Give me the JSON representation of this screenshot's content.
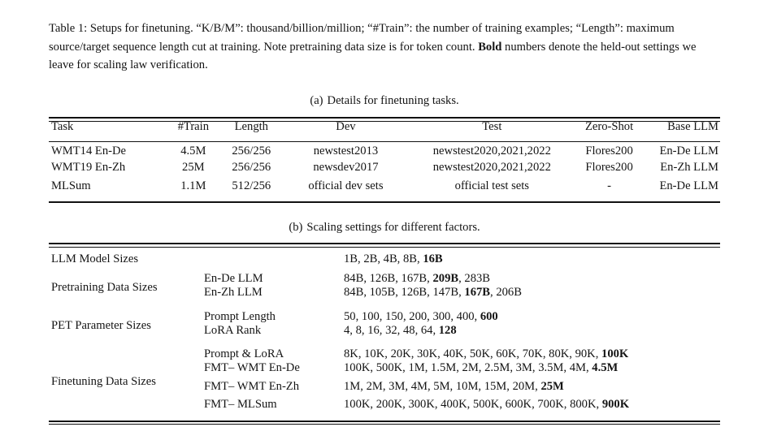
{
  "caption": {
    "lines": [
      "Table 1:  Setups for finetuning. “K/B/M”: thousand/billion/million; “#Train”: the number of training examples;",
      "“Length”: maximum source/target sequence length cut at training. Note pretraining data size is for token count.",
      "numbers denote the held-out settings we leave for scaling law verification."
    ],
    "bold_lead": "Bold"
  },
  "subtable_a": {
    "label": "(a)",
    "title": "Details for finetuning tasks.",
    "headers": [
      "Task",
      "#Train",
      "Length",
      "Dev",
      "Test",
      "Zero-Shot",
      "Base LLM"
    ],
    "rows": [
      {
        "task": "WMT14 En-De",
        "train": "4.5M",
        "length": "256/256",
        "dev": "newstest2013",
        "test": "newstest2020,2021,2022",
        "zero_shot": "Flores200",
        "base_llm": "En-De LLM"
      },
      {
        "task": "WMT19 En-Zh",
        "train": "25M",
        "length": "256/256",
        "dev": "newsdev2017",
        "test": "newstest2020,2021,2022",
        "zero_shot": "Flores200",
        "base_llm": "En-Zh LLM"
      },
      {
        "task": "MLSum",
        "train": "1.1M",
        "length": "512/256",
        "dev": "official dev sets",
        "test": "official test sets",
        "zero_shot": "-",
        "base_llm": "En-De LLM"
      }
    ]
  },
  "subtable_b": {
    "label": "(b)",
    "title": "Scaling settings for different factors.",
    "groups": [
      {
        "factor": "LLM Model Sizes",
        "rows": [
          {
            "sub": "",
            "values_plain": "1B, 2B, 4B, 8B, ",
            "values_bold": "16B"
          }
        ]
      },
      {
        "factor": "Pretraining Data Sizes",
        "rows": [
          {
            "sub": "En-De LLM",
            "values_plain": "84B, 126B, 167B, ",
            "values_bold": "209B",
            "values_tail": ", 283B"
          },
          {
            "sub": "En-Zh LLM",
            "values_plain": "84B, 105B, 126B, 147B, ",
            "values_bold": "167B",
            "values_tail": ", 206B"
          }
        ]
      },
      {
        "factor": "PET Parameter Sizes",
        "rows": [
          {
            "sub": "Prompt Length",
            "values_plain": "50, 100, 150, 200, 300, 400, ",
            "values_bold": "600",
            "values_tail": ""
          },
          {
            "sub": "LoRA Rank",
            "values_plain": "4, 8, 16, 32, 48, 64, ",
            "values_bold": "128",
            "values_tail": ""
          }
        ]
      },
      {
        "factor": "Finetuning Data Sizes",
        "rows": [
          {
            "sub": "Prompt & LoRA",
            "values_plain": "8K, 10K, 20K, 30K, 40K, 50K, 60K, 70K, 80K, 90K, ",
            "values_bold": "100K",
            "values_tail": ""
          },
          {
            "sub": "FMT– WMT En-De",
            "values_plain": "100K, 500K, 1M, 1.5M, 2M, 2.5M, 3M, 3.5M, 4M, ",
            "values_bold": "4.5M",
            "values_tail": ""
          },
          {
            "sub": "FMT– WMT En-Zh",
            "values_plain": "1M, 2M, 3M, 4M, 5M, 10M, 15M, 20M, ",
            "values_bold": "25M",
            "values_tail": ""
          },
          {
            "sub": "FMT– MLSum",
            "values_plain": "100K, 200K, 300K, 400K, 500K, 600K, 700K, 800K, ",
            "values_bold": "900K",
            "values_tail": ""
          }
        ]
      }
    ]
  }
}
